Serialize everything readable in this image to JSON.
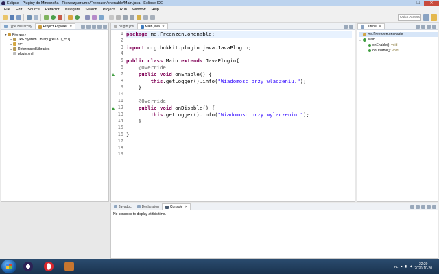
{
  "window": {
    "title": "Eclipse - Pluginy do Minecrafta - Pierwszy/src/me/Freenzen/onenable/Main.java - Eclipse IDE",
    "minimize": "—",
    "maximize": "❐",
    "close": "✕"
  },
  "menu": [
    "File",
    "Edit",
    "Source",
    "Refactor",
    "Navigate",
    "Search",
    "Project",
    "Run",
    "Window",
    "Help"
  ],
  "toolbar": {
    "quick_access_placeholder": "Quick Access"
  },
  "left_panel": {
    "tabs": [
      {
        "label": "Type Hierarchy",
        "active": false
      },
      {
        "label": "Project Explorer",
        "active": true
      }
    ],
    "tree": [
      {
        "label": "Pierwszy",
        "depth": 0,
        "twisty": "▾",
        "icon": "project-icon"
      },
      {
        "label": "JRE System Library [jre1.8.0_251]",
        "depth": 1,
        "twisty": "▸",
        "icon": "library-icon"
      },
      {
        "label": "src",
        "depth": 1,
        "twisty": "▸",
        "icon": "source-folder-icon"
      },
      {
        "label": "Referenced Libraries",
        "depth": 1,
        "twisty": "▸",
        "icon": "library-icon"
      },
      {
        "label": "plugin.yml",
        "depth": 1,
        "twisty": "",
        "icon": "file-icon"
      }
    ]
  },
  "editor": {
    "tabs": [
      {
        "label": "plugin.yml",
        "active": false
      },
      {
        "label": "Main.java",
        "active": true
      }
    ],
    "line_numbers": [
      "1",
      "2",
      "3",
      "4",
      "5",
      "6",
      "7",
      "8",
      "9",
      "10",
      "11",
      "12",
      "13",
      "14",
      "15",
      "16",
      "17",
      "18",
      "19"
    ],
    "lines": [
      [
        {
          "t": "package ",
          "c": "kw"
        },
        {
          "t": "me.Freenzen.onenable;",
          "c": ""
        }
      ],
      [],
      [
        {
          "t": "import ",
          "c": "kw"
        },
        {
          "t": "org.bukkit.plugin.java.JavaPlugin;",
          "c": ""
        }
      ],
      [],
      [
        {
          "t": "public ",
          "c": "kw"
        },
        {
          "t": "class ",
          "c": "kw"
        },
        {
          "t": "Main ",
          "c": ""
        },
        {
          "t": "extends ",
          "c": "kw"
        },
        {
          "t": "JavaPlugin{",
          "c": ""
        }
      ],
      [
        {
          "t": "    @Override",
          "c": "an"
        }
      ],
      [
        {
          "t": "    ",
          "c": ""
        },
        {
          "t": "public ",
          "c": "kw"
        },
        {
          "t": "void ",
          "c": "kw"
        },
        {
          "t": "onEnable() {",
          "c": ""
        }
      ],
      [
        {
          "t": "        ",
          "c": ""
        },
        {
          "t": "this",
          "c": "kw"
        },
        {
          "t": ".getLogger().info(",
          "c": ""
        },
        {
          "t": "\"Wiadomosc przy wlaczeniu.\"",
          "c": "str"
        },
        {
          "t": ");",
          "c": ""
        }
      ],
      [
        {
          "t": "    }",
          "c": ""
        }
      ],
      [],
      [
        {
          "t": "    @Override",
          "c": "an"
        }
      ],
      [
        {
          "t": "    ",
          "c": ""
        },
        {
          "t": "public ",
          "c": "kw"
        },
        {
          "t": "void ",
          "c": "kw"
        },
        {
          "t": "onDisable() {",
          "c": ""
        }
      ],
      [
        {
          "t": "        ",
          "c": ""
        },
        {
          "t": "this",
          "c": "kw"
        },
        {
          "t": ".getLogger().info(",
          "c": ""
        },
        {
          "t": "\"Wiadomosc przy wylaczeniu.\"",
          "c": "str"
        },
        {
          "t": ");",
          "c": ""
        }
      ],
      [
        {
          "t": "    }",
          "c": ""
        }
      ],
      [],
      [
        {
          "t": "}",
          "c": ""
        }
      ],
      [],
      [],
      []
    ]
  },
  "outline": {
    "tab": "Outline",
    "items": [
      {
        "label": "me.Freenzen.onenable",
        "ret": "",
        "depth": 0,
        "icon": "package-icon",
        "selected": true
      },
      {
        "label": "Main",
        "ret": "",
        "depth": 0,
        "icon": "class-icon",
        "selected": false
      },
      {
        "label": "onEnable()",
        "ret": " : void",
        "depth": 1,
        "icon": "method-icon",
        "selected": false
      },
      {
        "label": "onDisable()",
        "ret": " : void",
        "depth": 1,
        "icon": "method-icon",
        "selected": false
      }
    ]
  },
  "bottom_panel": {
    "tabs": [
      {
        "label": "Javadoc",
        "active": false
      },
      {
        "label": "Declaration",
        "active": false
      },
      {
        "label": "Console",
        "active": true
      }
    ],
    "message": "No consoles to display at this time."
  },
  "taskbar": {
    "language": "PL",
    "time": "22:29",
    "date": "2020-10-20"
  },
  "colors": {
    "keyword": "#7f0055",
    "string": "#2a00ff",
    "annotation": "#646464",
    "accent": "#3f9d3f"
  }
}
